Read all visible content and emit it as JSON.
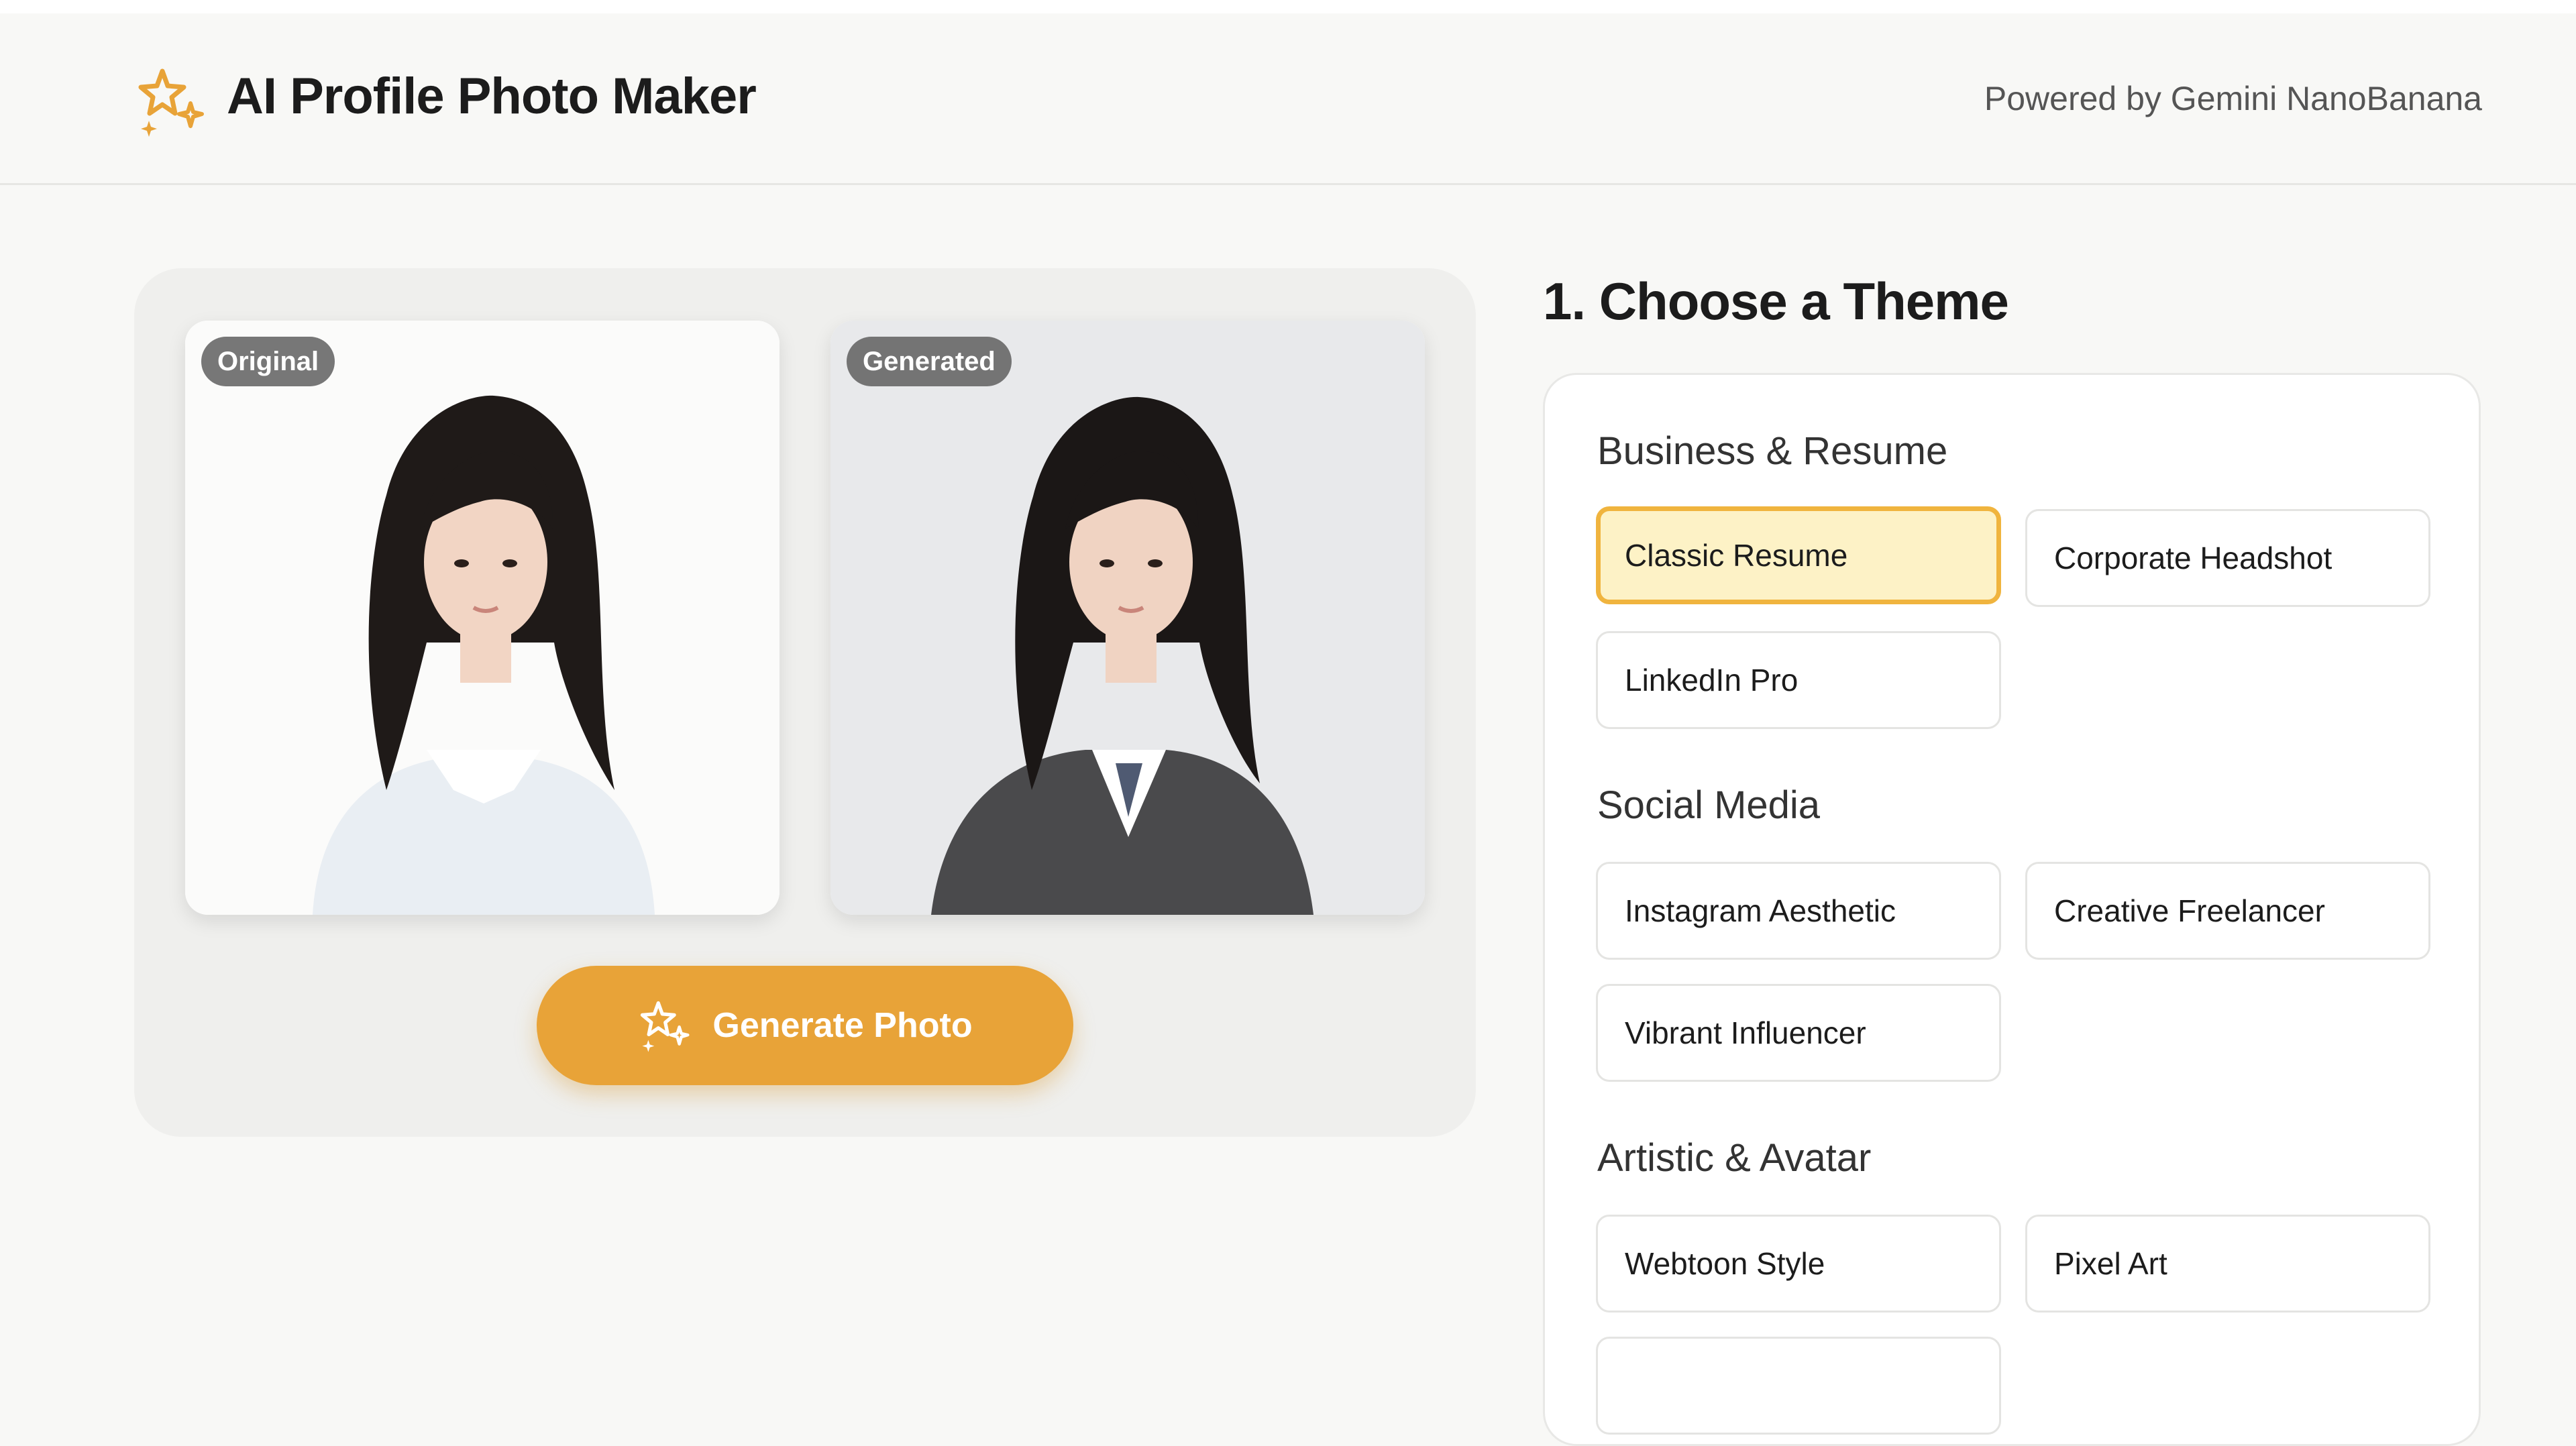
{
  "header": {
    "title": "AI Profile Photo Maker",
    "powered_by": "Powered by Gemini NanoBanana",
    "logo_icon": "sparkles-icon"
  },
  "preview": {
    "original_badge": "Original",
    "generated_badge": "Generated",
    "generate_button": "Generate Photo",
    "generate_icon": "sparkles-icon"
  },
  "themes": {
    "step_title": "1. Choose a Theme",
    "groups": [
      {
        "title": "Business & Resume",
        "items": [
          "Classic Resume",
          "Corporate Headshot",
          "LinkedIn Pro"
        ]
      },
      {
        "title": "Social Media",
        "items": [
          "Instagram Aesthetic",
          "Creative Freelancer",
          "Vibrant Influencer"
        ]
      },
      {
        "title": "Artistic & Avatar",
        "items": [
          "Webtoon Style",
          "Pixel Art"
        ]
      }
    ],
    "selected": "Classic Resume"
  },
  "colors": {
    "accent": "#e8a338",
    "selected_bg": "#fdf2c6",
    "selected_border": "#f0b43e",
    "background": "#f8f8f6"
  }
}
